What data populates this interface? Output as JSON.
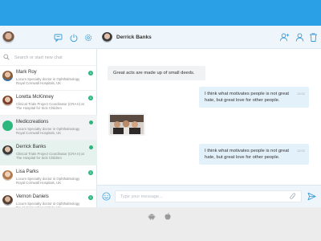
{
  "sidebar": {
    "search": {
      "placeholder": "Search or start new chat"
    },
    "contacts": [
      {
        "name": "Mark Roy",
        "line1": "Locum Specialty doctor in Ophthalmology",
        "line2": "Royal Cornwall Hospitals, UK",
        "badge": "1"
      },
      {
        "name": "Loretta McKinney",
        "line1": "Clinical Trials Project Coordinator (CRA II) at",
        "line2": "The Hospital for Sick Children",
        "badge": "1"
      },
      {
        "name": "Mediccreations",
        "line1": "Locum Specialty doctor in Ophthalmology",
        "line2": "Royal Cornwall Hospitals, UK",
        "badge": ""
      },
      {
        "name": "Derrick Banks",
        "line1": "Clinical Trials Project Coordinator (CRA II) at",
        "line2": "The Hospital for Sick Children",
        "badge": ""
      },
      {
        "name": "Lisa Parks",
        "line1": "Locum Specialty doctor in Ophthalmology",
        "line2": "Royal Cornwall Hospitals, UK",
        "badge": "1"
      },
      {
        "name": "Vernon Daniels",
        "line1": "Locum Specialty doctor in Ophthalmology",
        "line2": "Royal Cornwall Hospitals, UK",
        "badge": "1"
      }
    ]
  },
  "chat": {
    "contact_name": "Derrick Banks",
    "messages": [
      {
        "text": "Great acts are made up of small deeds.",
        "time": ""
      },
      {
        "text": "I think what motivates people is not great hate, but great love for other people.",
        "time": "12:02"
      },
      {
        "text": "I think what motivates people is not great hate, but great love for other people.",
        "time": "12:02"
      }
    ],
    "composer_placeholder": "Type your message..."
  },
  "colors": {
    "brand": "#2aa0e6",
    "online": "#2bb77e",
    "active_row": "#e5f2ee"
  }
}
